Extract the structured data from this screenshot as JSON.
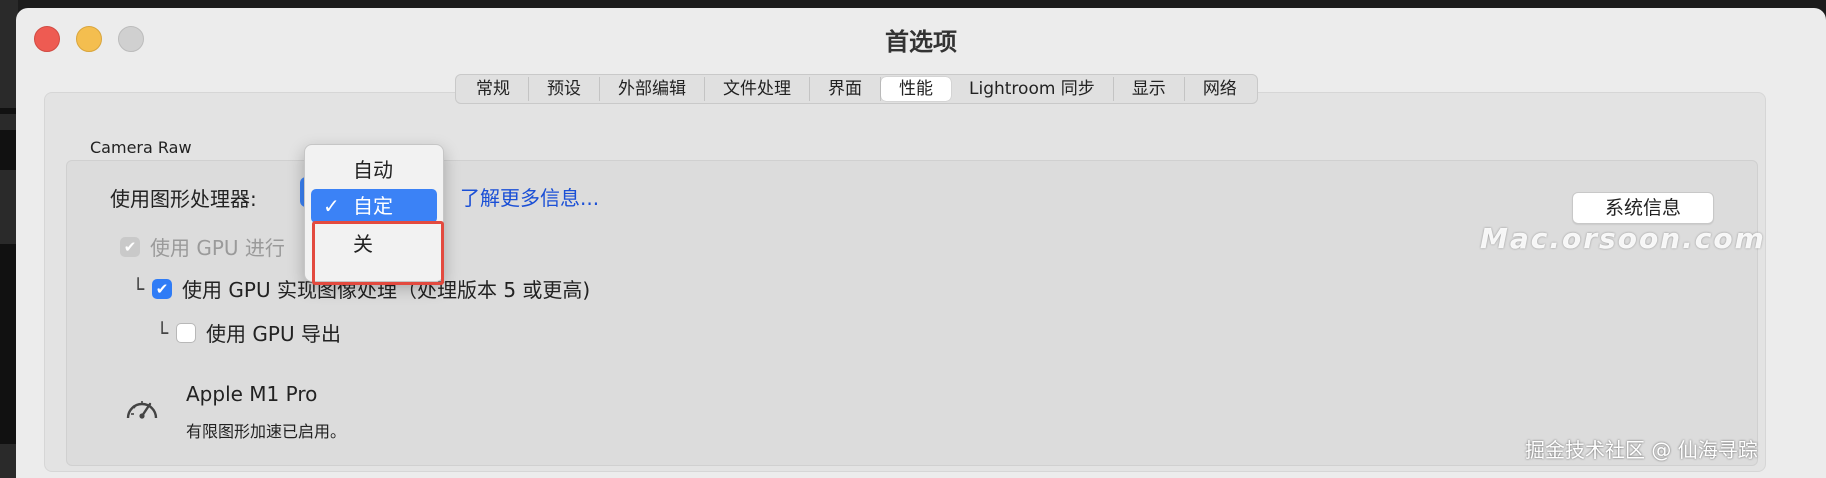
{
  "window": {
    "title": "首选项"
  },
  "tabs": [
    {
      "label": "常规"
    },
    {
      "label": "预设"
    },
    {
      "label": "外部编辑"
    },
    {
      "label": "文件处理"
    },
    {
      "label": "界面"
    },
    {
      "label": "性能",
      "active": true
    },
    {
      "label": "Lightroom 同步"
    },
    {
      "label": "显示"
    },
    {
      "label": "网络"
    }
  ],
  "section": {
    "label": "Camera Raw"
  },
  "gpu": {
    "label": "使用图形处理器:",
    "learn_more": "了解更多信息...",
    "system_info_button": "系统信息",
    "selected_value": "自定"
  },
  "popup_menu": {
    "items": [
      "自动",
      "自定",
      "关"
    ],
    "selected_index": 1,
    "check_glyph": "✓"
  },
  "options": {
    "use_gpu_for": "使用 GPU 进行",
    "use_gpu_for_checked": true,
    "use_gpu_for_disabled": true,
    "gpu_image_processing": "使用 GPU 实现图像处理（处理版本 5 或更高)",
    "gpu_image_processing_checked": true,
    "gpu_export": "使用 GPU 导出",
    "gpu_export_checked": false,
    "tree_glyph": "└"
  },
  "device": {
    "name": "Apple M1 Pro",
    "status": "有限图形加速已启用。",
    "icon": "speedometer-icon"
  },
  "overlays": {
    "watermark": "Mac.orsoon.com",
    "footer": "掘金技术社区 @ 仙海寻踪"
  },
  "colors": {
    "accent": "#3b82f6",
    "highlight_box": "#e34a3f",
    "link": "#1a4fd6"
  }
}
